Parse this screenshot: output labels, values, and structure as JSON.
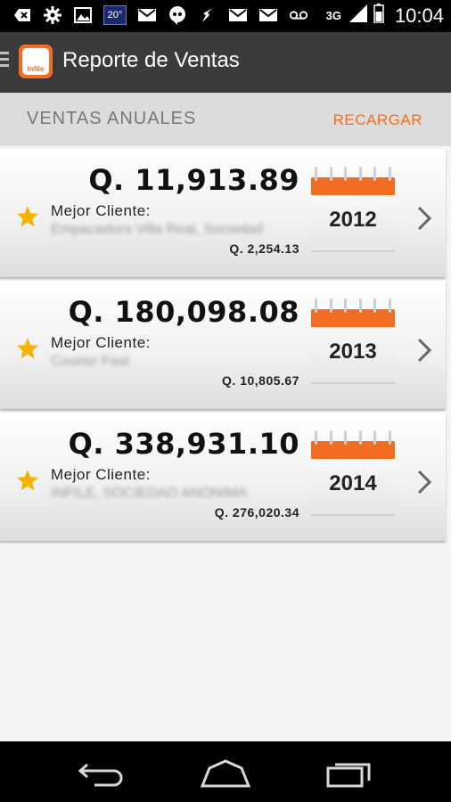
{
  "status_bar": {
    "temperature": "20°",
    "network": "3G",
    "time": "10:04",
    "icons": [
      "back-icon",
      "settings-icon",
      "image-icon",
      "temperature-icon",
      "gmail-icon",
      "hangouts-icon",
      "bird-icon",
      "gmail-icon",
      "gmail-icon",
      "voicemail-icon",
      "signal-icon",
      "battery-icon"
    ]
  },
  "app_bar": {
    "logo_text": "Infile",
    "title": "Reporte de Ventas"
  },
  "section": {
    "title": "VENTAS ANUALES",
    "reload_label": "RECARGAR"
  },
  "reports": [
    {
      "amount": "Q. 11,913.89",
      "best_client_label": "Mejor Cliente:",
      "best_client_name": "Empacadora Villa Real, Sociedad",
      "best_client_amount": "Q. 2,254.13",
      "year": "2012"
    },
    {
      "amount": "Q. 180,098.08",
      "best_client_label": "Mejor Cliente:",
      "best_client_name": "Courier Fast",
      "best_client_amount": "Q. 10,805.67",
      "year": "2013"
    },
    {
      "amount": "Q. 338,931.10",
      "best_client_label": "Mejor Cliente:",
      "best_client_name": "INFILE, SOCIEDAD ANONIMA",
      "best_client_amount": "Q. 276,020.34",
      "year": "2014"
    }
  ],
  "colors": {
    "accent": "#f26d21",
    "appbar": "#3b3b3b",
    "star": "#f5b301"
  }
}
